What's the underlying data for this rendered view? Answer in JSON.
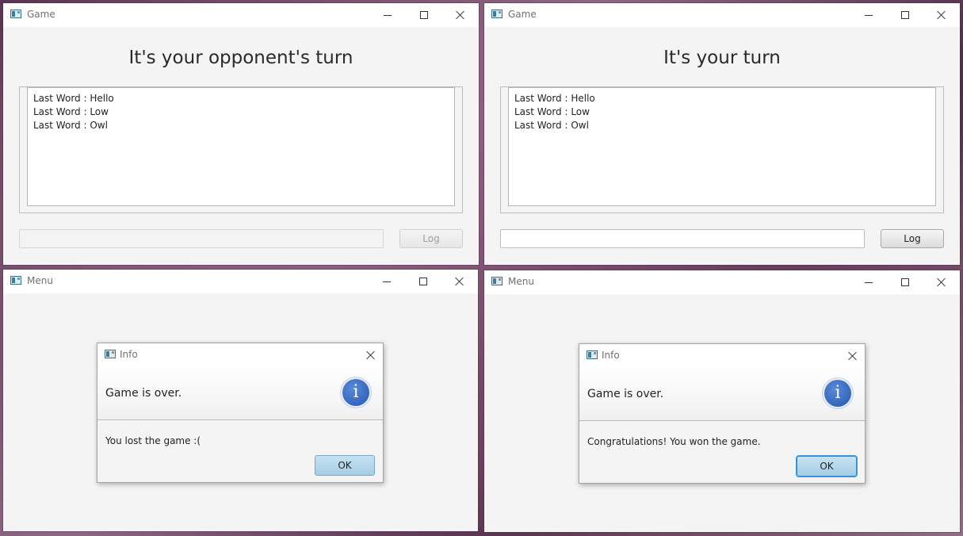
{
  "windows": {
    "game_opponent": {
      "title": "Game",
      "heading": "It's your opponent's turn",
      "log_lines": [
        "Last Word : Hello",
        "Last Word : Low",
        "Last Word : Owl"
      ],
      "input_value": "",
      "log_button": "Log"
    },
    "game_self": {
      "title": "Game",
      "heading": "It's your turn",
      "log_lines": [
        "Last Word : Hello",
        "Last Word : Low",
        "Last Word : Owl"
      ],
      "input_value": "",
      "log_button": "Log"
    },
    "menu_lost": {
      "title": "Menu",
      "dialog": {
        "title": "Info",
        "header": "Game is over.",
        "icon_glyph": "i",
        "content": "You lost the game :(",
        "ok": "OK"
      }
    },
    "menu_won": {
      "title": "Menu",
      "dialog": {
        "title": "Info",
        "header": "Game is over.",
        "icon_glyph": "i",
        "content": "Congratulations! You won the game.",
        "ok": "OK"
      }
    }
  },
  "icons": {
    "app": "app-window-icon",
    "minimize": "minimize-icon",
    "maximize": "maximize-icon",
    "close": "close-icon",
    "info": "info-icon"
  },
  "colors": {
    "info_icon": "#2457b5",
    "ok_button": "#a5cde3",
    "focus_ring": "#3d9be0"
  }
}
